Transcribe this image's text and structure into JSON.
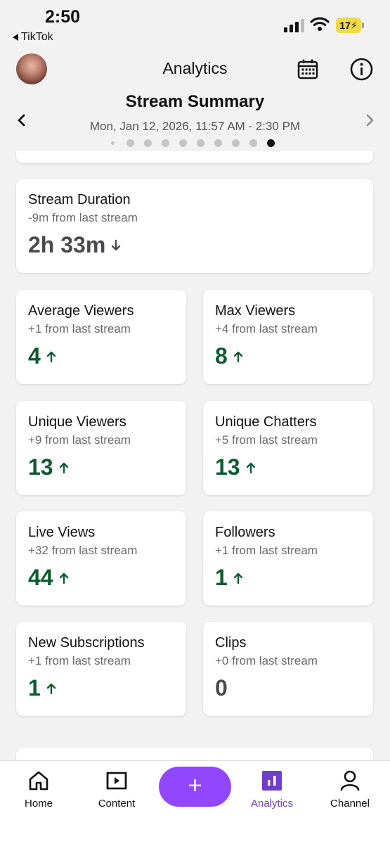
{
  "status_bar": {
    "time": "2:50",
    "back_app": "TikTok",
    "battery": "17"
  },
  "header": {
    "title": "Analytics"
  },
  "summary": {
    "title": "Stream Summary",
    "date_range": "Mon, Jan 12, 2026, 11:57 AM - 2:30 PM",
    "pages_total": 10,
    "active_page": 10
  },
  "stats": {
    "duration": {
      "label": "Stream Duration",
      "change": "-9m from last stream",
      "value": "2h 33m",
      "trend": "down"
    },
    "average_viewers": {
      "label": "Average Viewers",
      "change": "+1 from last stream",
      "value": "4",
      "trend": "up"
    },
    "max_viewers": {
      "label": "Max Viewers",
      "change": "+4 from last stream",
      "value": "8",
      "trend": "up"
    },
    "unique_viewers": {
      "label": "Unique Viewers",
      "change": "+9 from last stream",
      "value": "13",
      "trend": "up"
    },
    "unique_chatters": {
      "label": "Unique Chatters",
      "change": "+5 from last stream",
      "value": "13",
      "trend": "up"
    },
    "live_views": {
      "label": "Live Views",
      "change": "+32 from last stream",
      "value": "44",
      "trend": "up"
    },
    "followers": {
      "label": "Followers",
      "change": "+1 from last stream",
      "value": "1",
      "trend": "up"
    },
    "new_subscriptions": {
      "label": "New Subscriptions",
      "change": "+1 from last stream",
      "value": "1",
      "trend": "up"
    },
    "clips": {
      "label": "Clips",
      "change": "+0 from last stream",
      "value": "0",
      "trend": "none"
    }
  },
  "nav": {
    "home": "Home",
    "content": "Content",
    "create": "+",
    "analytics": "Analytics",
    "channel": "Channel"
  },
  "colors": {
    "accent": "#9146ff",
    "active_nav": "#6e3fc9",
    "positive": "#0d5a32",
    "neutral_value": "#4a4a50"
  }
}
